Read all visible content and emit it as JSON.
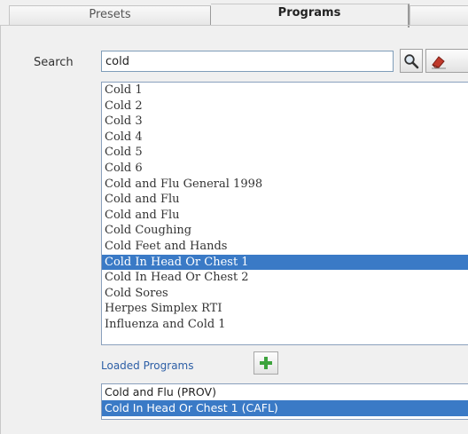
{
  "tabs": [
    {
      "label": "Presets"
    },
    {
      "label": "Programs"
    }
  ],
  "search": {
    "label": "Search",
    "value": "cold"
  },
  "results": [
    {
      "label": "Cold 1"
    },
    {
      "label": "Cold 2"
    },
    {
      "label": "Cold 3"
    },
    {
      "label": "Cold 4"
    },
    {
      "label": "Cold 5"
    },
    {
      "label": "Cold 6"
    },
    {
      "label": "Cold and Flu General 1998"
    },
    {
      "label": "Cold and Flu"
    },
    {
      "label": "Cold and Flu"
    },
    {
      "label": "Cold Coughing"
    },
    {
      "label": "Cold Feet and Hands"
    },
    {
      "label": "Cold In Head Or Chest 1",
      "selected": true
    },
    {
      "label": "Cold In Head Or Chest 2"
    },
    {
      "label": "Cold Sores"
    },
    {
      "label": "Herpes Simplex RTI"
    },
    {
      "label": "Influenza and Cold 1"
    }
  ],
  "loaded": {
    "label": "Loaded Programs",
    "items": [
      {
        "label": "Cold and Flu (PROV)"
      },
      {
        "label": "Cold In Head Or Chest 1 (CAFL)",
        "selected": true
      }
    ]
  },
  "icons": {
    "search": "magnifier-icon",
    "clear": "eraser-icon",
    "add": "plus-icon"
  },
  "colors": {
    "selection": "#3a7ac6",
    "add_green": "#3da33d",
    "link_blue": "#2d5fa6"
  }
}
